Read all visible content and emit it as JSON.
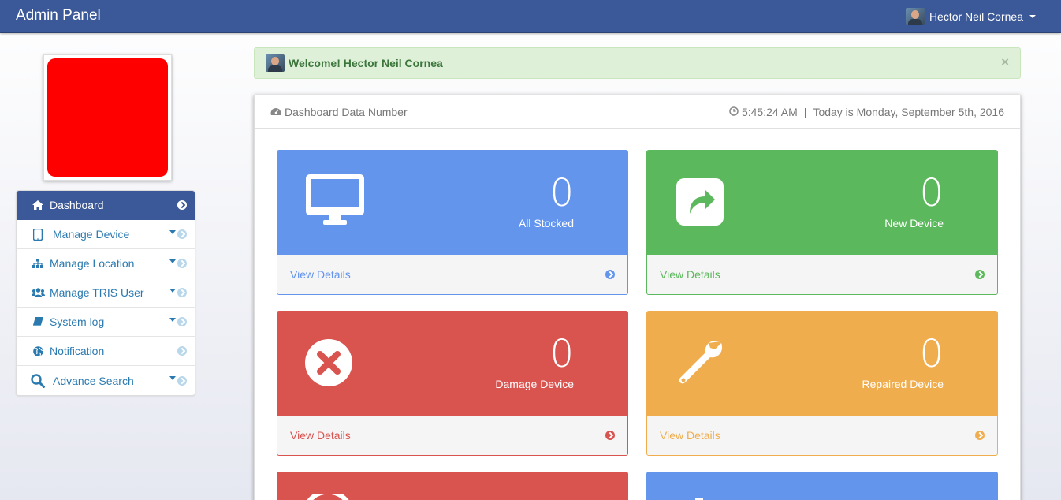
{
  "navbar": {
    "brand": "Admin Panel",
    "user_name": "Hector Neil Cornea"
  },
  "sidebar": {
    "items": [
      {
        "label": "Dashboard",
        "icon": "home-icon",
        "active": true
      },
      {
        "label": "Manage Device",
        "icon": "tablet-icon",
        "dropdown": true
      },
      {
        "label": "Manage Location",
        "icon": "sitemap-icon",
        "dropdown": true
      },
      {
        "label": "Manage TRIS User",
        "icon": "users-icon",
        "dropdown": true
      },
      {
        "label": "System log",
        "icon": "book-icon",
        "dropdown": true
      },
      {
        "label": "Notification",
        "icon": "globe-icon",
        "dropdown": false
      },
      {
        "label": "Advance Search",
        "icon": "search-icon",
        "dropdown": true
      }
    ]
  },
  "alert": {
    "text": "Welcome! Hector Neil Cornea",
    "close": "×"
  },
  "panel": {
    "title": "Dashboard Data Number",
    "time": "5:45:24 AM",
    "separator": "|",
    "date_text": "Today is Monday, September 5th, 2016"
  },
  "cards": [
    {
      "value": "0",
      "label": "All Stocked",
      "link": "View Details",
      "color": "#6495ed",
      "icon": "monitor-icon"
    },
    {
      "value": "0",
      "label": "New Device",
      "link": "View Details",
      "color": "#5cb85c",
      "icon": "share-square-icon"
    },
    {
      "value": "0",
      "label": "Damage Device",
      "link": "View Details",
      "color": "#d9534f",
      "icon": "times-circle-icon"
    },
    {
      "value": "0",
      "label": "Repaired Device",
      "link": "View Details",
      "color": "#f0ad4e",
      "icon": "wrench-icon"
    }
  ]
}
